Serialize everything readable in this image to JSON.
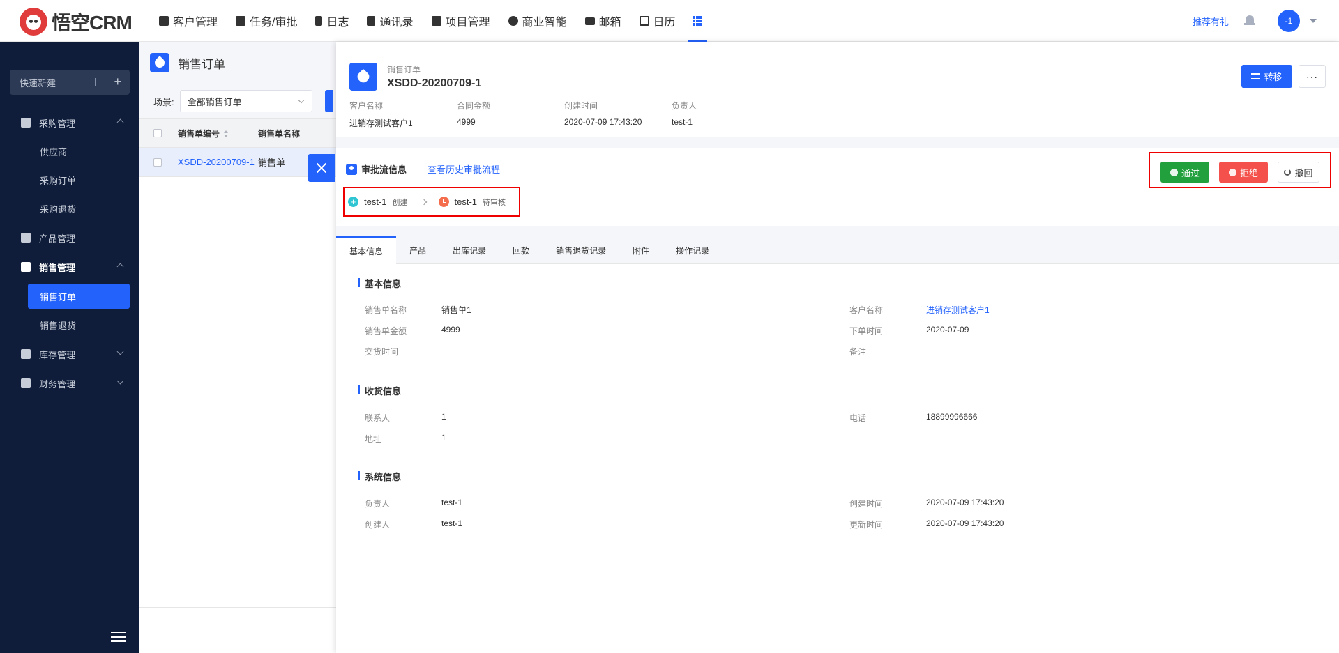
{
  "app": {
    "logo_text": "悟空CRM",
    "brand_color": "#2362fb"
  },
  "nav": {
    "items": [
      {
        "label": "客户管理",
        "icon": "customer-icon"
      },
      {
        "label": "任务/审批",
        "icon": "briefcase-icon"
      },
      {
        "label": "日志",
        "icon": "log-icon"
      },
      {
        "label": "通讯录",
        "icon": "phone-book-icon"
      },
      {
        "label": "项目管理",
        "icon": "project-icon"
      },
      {
        "label": "商业智能",
        "icon": "bi-icon"
      },
      {
        "label": "邮箱",
        "icon": "mail-icon"
      },
      {
        "label": "日历",
        "icon": "calendar-icon"
      }
    ],
    "recommend": "推荐有礼",
    "avatar": "-1"
  },
  "sidebar": {
    "quick_new": "快速新建",
    "groups": [
      {
        "label": "采购管理",
        "icon": "cart-icon",
        "expanded": true,
        "items": [
          "供应商",
          "采购订单",
          "采购退货"
        ]
      },
      {
        "label": "产品管理",
        "icon": "box-icon"
      },
      {
        "label": "销售管理",
        "icon": "tag-icon",
        "expanded": true,
        "items": [
          "销售订单",
          "销售退货"
        ],
        "active_item": "销售订单"
      },
      {
        "label": "库存管理",
        "icon": "warehouse-icon"
      },
      {
        "label": "财务管理",
        "icon": "wallet-icon"
      }
    ]
  },
  "list": {
    "title": "销售订单",
    "scene_label": "场景:",
    "scene_value": "全部销售订单",
    "columns": [
      "销售单编号",
      "销售单名称"
    ],
    "row": {
      "no": "XSDD-20200709-1",
      "name": "销售单"
    }
  },
  "detail": {
    "type": "销售订单",
    "number": "XSDD-20200709-1",
    "summary": [
      {
        "k": "客户名称",
        "v": "进销存测试客户1"
      },
      {
        "k": "合同金额",
        "v": "4999"
      },
      {
        "k": "创建时间",
        "v": "2020-07-09 17:43:20"
      },
      {
        "k": "负责人",
        "v": "test-1"
      }
    ],
    "transfer": "转移",
    "more": "···",
    "approval": {
      "title": "审批流信息",
      "history_link": "查看历史审批流程",
      "flow": [
        {
          "user": "test-1",
          "status": "创建"
        },
        {
          "user": "test-1",
          "status": "待审核"
        }
      ],
      "pass": "通过",
      "reject": "拒绝",
      "recall": "撤回"
    },
    "tabs": [
      "基本信息",
      "产品",
      "出库记录",
      "回款",
      "销售退货记录",
      "附件",
      "操作记录"
    ],
    "sections": {
      "basic": {
        "title": "基本信息",
        "name_k": "销售单名称",
        "name_v": "销售单1",
        "amount_k": "销售单金额",
        "amount_v": "4999",
        "deliver_k": "交货时间",
        "deliver_v": "",
        "customer_k": "客户名称",
        "customer_v": "进销存测试客户1",
        "order_k": "下单时间",
        "order_v": "2020-07-09",
        "remark_k": "备注",
        "remark_v": ""
      },
      "shipping": {
        "title": "收货信息",
        "contact_k": "联系人",
        "contact_v": "1",
        "address_k": "地址",
        "address_v": "1",
        "phone_k": "电话",
        "phone_v": "18899996666"
      },
      "system": {
        "title": "系统信息",
        "owner_k": "负责人",
        "owner_v": "test-1",
        "creator_k": "创建人",
        "creator_v": "test-1",
        "created_k": "创建时间",
        "created_v": "2020-07-09 17:43:20",
        "updated_k": "更新时间",
        "updated_v": "2020-07-09 17:43:20"
      }
    }
  }
}
